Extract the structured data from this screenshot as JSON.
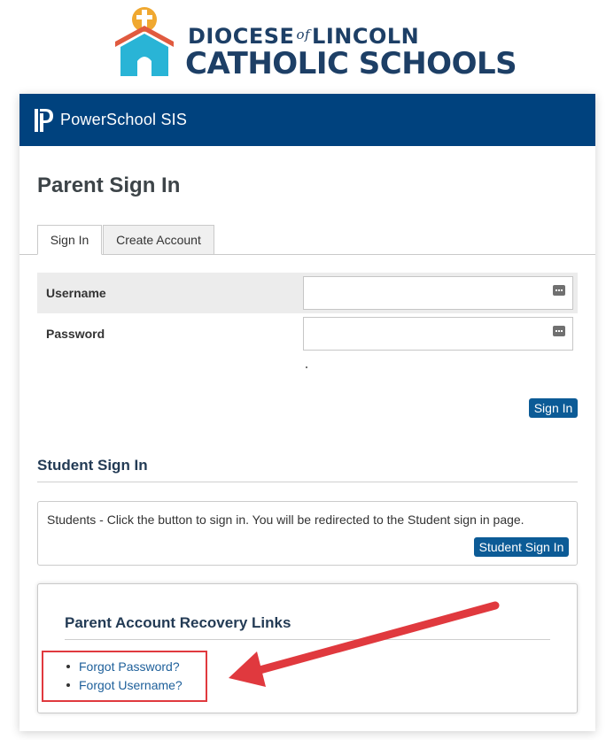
{
  "brand": {
    "line1_left": "DIOCESE",
    "line1_of": "of",
    "line1_right": "LINCOLN",
    "line2": "CATHOLIC SCHOOLS",
    "colors": {
      "navy": "#1d3f66",
      "orange": "#f0a830",
      "red": "#e05a3f",
      "teal": "#29b4d6"
    }
  },
  "header": {
    "app_name": "PowerSchool SIS",
    "logo_icon": "powerschool-p-icon",
    "color": "#00427e"
  },
  "page": {
    "title": "Parent Sign In"
  },
  "tabs": [
    {
      "label": "Sign In",
      "active": true
    },
    {
      "label": "Create Account",
      "active": false
    }
  ],
  "form": {
    "username_label": "Username",
    "username_value": "",
    "password_label": "Password",
    "password_value": "",
    "field_icon": "password-manager-icon",
    "submit_label": "Sign In"
  },
  "student": {
    "title": "Student Sign In",
    "text": "Students - Click the button to sign in. You will be redirected to the Student sign in page.",
    "button_label": "Student Sign In"
  },
  "recovery": {
    "title": "Parent Account Recovery Links",
    "links": [
      "Forgot Password?",
      "Forgot Username?"
    ]
  },
  "annotation": {
    "arrow_color": "#e0393e"
  },
  "colors": {
    "button": "#0c5b96",
    "link": "#1d5f9a"
  }
}
